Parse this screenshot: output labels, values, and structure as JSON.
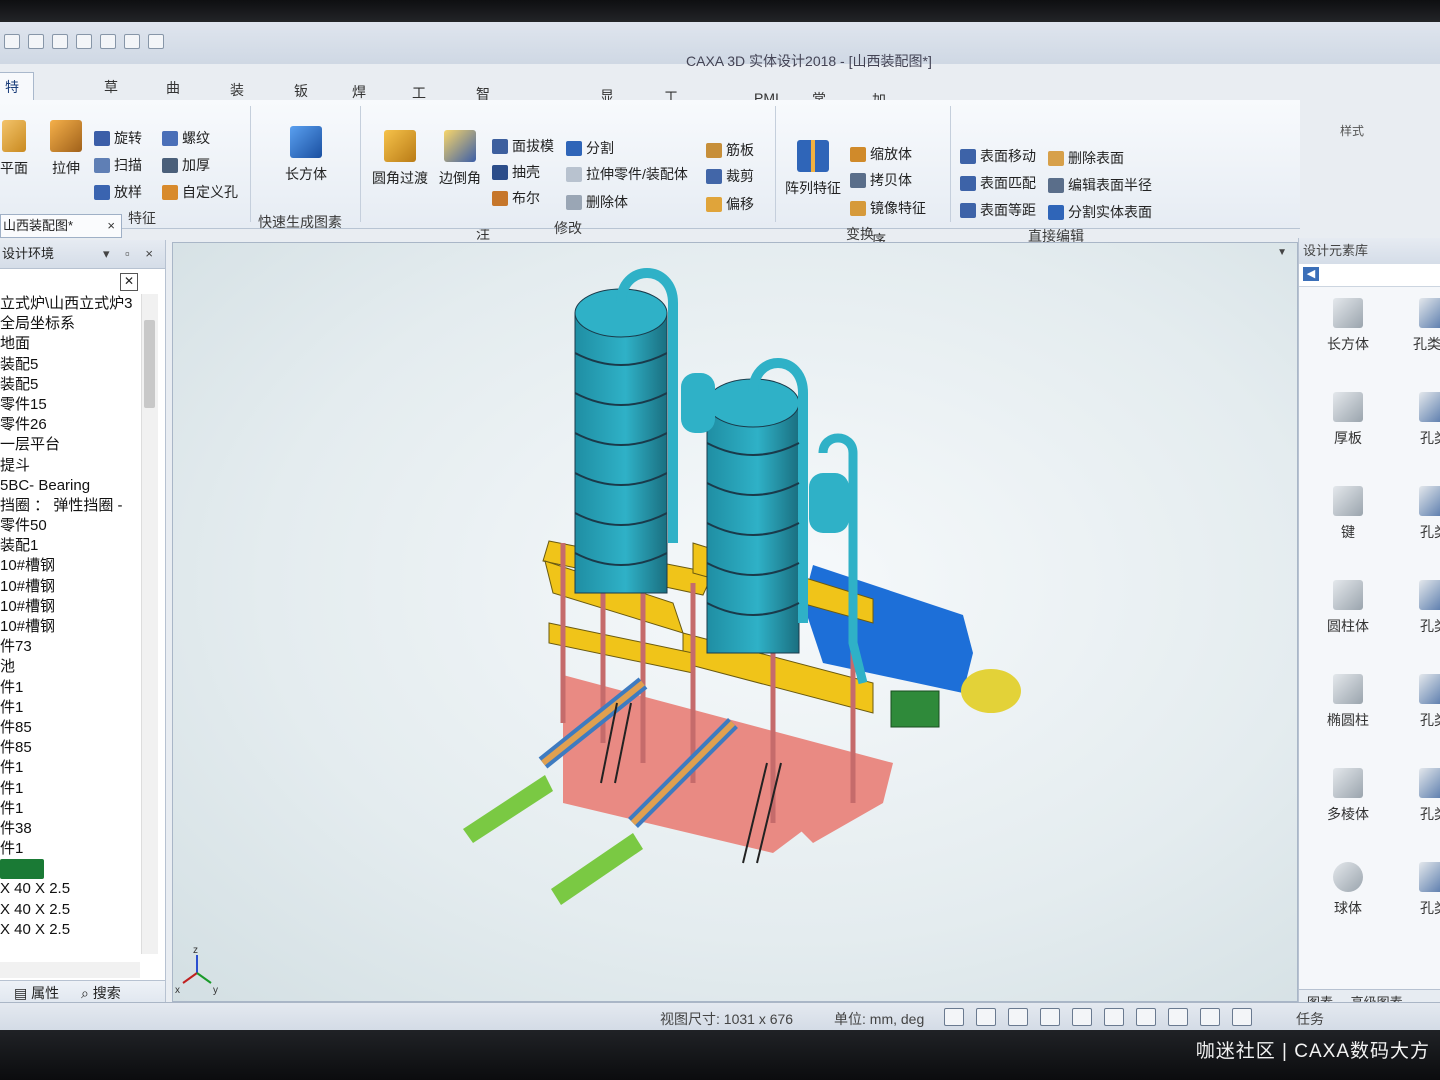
{
  "app": {
    "window_title": "CAXA 3D 实体设计2018 - [山西装配图*]"
  },
  "ribbon": {
    "tabs": [
      "特征",
      "草图",
      "曲面",
      "装配",
      "钣金",
      "焊接",
      "工具",
      "智能设计批注",
      "显示",
      "工程标注",
      "PMI",
      "常用",
      "加载应用程序"
    ],
    "active_tab": "特征",
    "groups": {
      "feature_label": "特征",
      "quick_label": "快速生成图素",
      "modify_label": "修改",
      "transform_label": "变换",
      "direct_edit_label": "直接编辑"
    },
    "buttons": {
      "plane": "平面",
      "extrude": "拉伸",
      "revolve": "旋转",
      "thread": "螺纹",
      "sweep": "扫描",
      "thicken": "加厚",
      "loft": "放样",
      "custom_hole": "自定义孔",
      "box": "长方体",
      "fillet": "圆角过渡",
      "chamfer": "边倒角",
      "draft": "面拔模",
      "split": "分割",
      "shell": "抽壳",
      "extrude_part": "拉伸零件/装配体",
      "boolean": "布尔",
      "delete_body": "删除体",
      "rib": "筋板",
      "trim": "裁剪",
      "offset": "偏移",
      "pattern": "阵列特征",
      "scale": "缩放体",
      "copy_body": "拷贝体",
      "mirror": "镜像特征",
      "face_move": "表面移动",
      "delete_face": "删除表面",
      "face_match": "表面匹配",
      "edit_radius": "编辑表面半径",
      "face_equal": "表面等距",
      "split_solid_face": "分割实体表面"
    },
    "right_corner": "样式"
  },
  "doc_tab": {
    "label": "山西装配图*"
  },
  "design_tree": {
    "header": "设计环境",
    "items": [
      "立式炉\\山西立式炉3",
      "全局坐标系",
      "地面",
      "装配5",
      "装配5",
      "零件15",
      "零件26",
      "一层平台",
      "提斗",
      "5BC- Bearing",
      "挡圈 ： 弹性挡圈 -",
      "零件50",
      "装配1",
      "10#槽钢",
      "10#槽钢",
      "10#槽钢",
      "10#槽钢",
      "件73",
      "池",
      "件1",
      "件1",
      "件85",
      "件85",
      "件1",
      "件1",
      "件1",
      "件38",
      "件1",
      "",
      "X 40 X 2.5",
      "X 40 X 2.5",
      "X 40 X 2.5"
    ],
    "selected_index": 28,
    "footer_tabs": [
      "属性",
      "搜索"
    ]
  },
  "viewport": {
    "axis_labels": [
      "z",
      "x",
      "y"
    ]
  },
  "design_library": {
    "header": "设计元素库",
    "elements": [
      {
        "label": "长方体",
        "color": "#9aa4ad"
      },
      {
        "label": "孔类长",
        "color": "#4a6fa5"
      },
      {
        "label": "厚板",
        "color": "#9aa4ad"
      },
      {
        "label": "孔类",
        "color": "#4a6fa5"
      },
      {
        "label": "键",
        "color": "#9aa4ad"
      },
      {
        "label": "孔类",
        "color": "#4a6fa5"
      },
      {
        "label": "圆柱体",
        "color": "#9aa4ad"
      },
      {
        "label": "孔类",
        "color": "#4a6fa5"
      },
      {
        "label": "椭圆柱",
        "color": "#9aa4ad"
      },
      {
        "label": "孔类",
        "color": "#4a6fa5"
      },
      {
        "label": "多棱体",
        "color": "#9aa4ad"
      },
      {
        "label": "孔类",
        "color": "#4a6fa5"
      },
      {
        "label": "球体",
        "color": "#9aa4ad"
      },
      {
        "label": "孔类",
        "color": "#4a6fa5"
      }
    ],
    "footer_tabs": [
      "图素",
      "高级图素"
    ]
  },
  "statusbar": {
    "view_size": "视图尺寸: 1031 x  676",
    "unit": "单位: mm, deg",
    "task": "任务"
  },
  "watermark": "咖迷社区 | CAXA数码大方",
  "colors": {
    "silo": "#2fb1c7",
    "frame": "#f0c419",
    "floor": "#e98a83",
    "conveyor": "#7ac943",
    "blue_box": "#1d6fd8",
    "tank": "#e3d238"
  }
}
